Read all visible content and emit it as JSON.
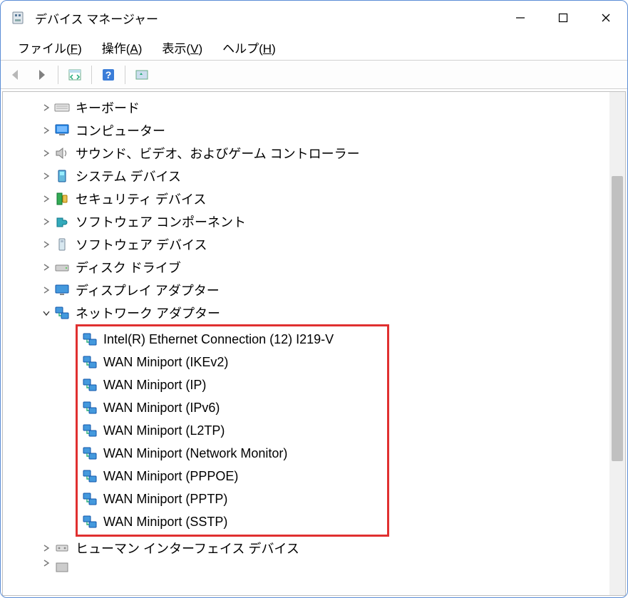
{
  "window": {
    "title": "デバイス マネージャー"
  },
  "menu": {
    "file": "ファイル(",
    "file_u": "F",
    "file2": ")",
    "action": "操作(",
    "action_u": "A",
    "action2": ")",
    "view": "表示(",
    "view_u": "V",
    "view2": ")",
    "help": "ヘルプ(",
    "help_u": "H",
    "help2": ")"
  },
  "tree": {
    "nodes": [
      {
        "label": "キーボード",
        "icon": "keyboard"
      },
      {
        "label": "コンピューター",
        "icon": "computer"
      },
      {
        "label": "サウンド、ビデオ、およびゲーム コントローラー",
        "icon": "sound"
      },
      {
        "label": "システム デバイス",
        "icon": "system"
      },
      {
        "label": "セキュリティ デバイス",
        "icon": "security"
      },
      {
        "label": "ソフトウェア コンポーネント",
        "icon": "component"
      },
      {
        "label": "ソフトウェア デバイス",
        "icon": "softdev"
      },
      {
        "label": "ディスク ドライブ",
        "icon": "disk"
      },
      {
        "label": "ディスプレイ アダプター",
        "icon": "display"
      }
    ],
    "network": {
      "label": "ネットワーク アダプター",
      "children": [
        "Intel(R) Ethernet Connection (12) I219-V",
        "WAN Miniport (IKEv2)",
        "WAN Miniport (IP)",
        "WAN Miniport (IPv6)",
        "WAN Miniport (L2TP)",
        "WAN Miniport (Network Monitor)",
        "WAN Miniport (PPPOE)",
        "WAN Miniport (PPTP)",
        "WAN Miniport (SSTP)"
      ]
    },
    "hid": {
      "label": "ヒューマン インターフェイス デバイス"
    }
  }
}
